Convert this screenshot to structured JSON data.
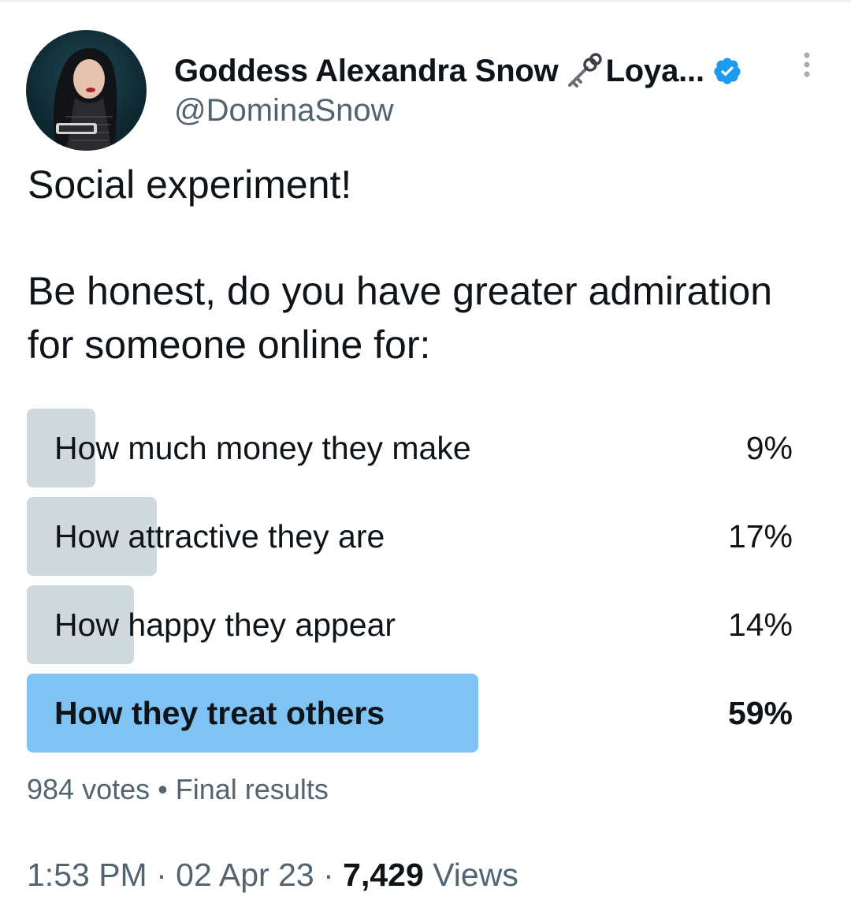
{
  "author": {
    "display_name": "Goddess Alexandra Snow",
    "name_suffix": "Loya...",
    "handle": "@DominaSnow",
    "verified_color": "#1d9bf0",
    "name_icon": "key-icon"
  },
  "tweet": {
    "paragraphs": [
      "Social experiment!",
      "Be honest, do you have greater admiration for someone online for:"
    ]
  },
  "poll": {
    "options": [
      {
        "label": "How much money they make",
        "percent_label": "9%",
        "percent": 9,
        "winner": false
      },
      {
        "label": "How attractive they are",
        "percent_label": "17%",
        "percent": 17,
        "winner": false
      },
      {
        "label": "How happy they appear",
        "percent_label": "14%",
        "percent": 14,
        "winner": false
      },
      {
        "label": "How they treat others",
        "percent_label": "59%",
        "percent": 59,
        "winner": true
      }
    ],
    "votes": "984 votes",
    "separator": "•",
    "status": "Final results",
    "bar_color": "#cfd9de",
    "winner_bar_color": "#7fc3f5"
  },
  "meta": {
    "time": "1:53 PM",
    "sep": "·",
    "date": "02 Apr 23",
    "views_count": "7,429",
    "views_label": "Views"
  }
}
